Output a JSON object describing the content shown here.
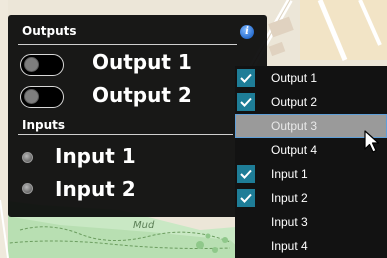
{
  "map": {
    "label": "Mud"
  },
  "panel": {
    "outputs_title": "Outputs",
    "inputs_title": "Inputs",
    "info_icon": "i",
    "outputs": [
      {
        "label": "Output 1",
        "state": "off"
      },
      {
        "label": "Output 2",
        "state": "off"
      }
    ],
    "inputs": [
      {
        "label": "Input 1",
        "state": "inactive"
      },
      {
        "label": "Input 2",
        "state": "inactive"
      }
    ]
  },
  "menu": {
    "items": [
      {
        "label": "Output 1",
        "checked": true
      },
      {
        "label": "Output 2",
        "checked": true
      },
      {
        "label": "Output 3",
        "checked": false,
        "highlighted": true
      },
      {
        "label": "Output 4",
        "checked": false
      },
      {
        "label": "Input 1",
        "checked": true
      },
      {
        "label": "Input 2",
        "checked": true
      },
      {
        "label": "Input 3",
        "checked": false
      },
      {
        "label": "Input 4",
        "checked": false
      }
    ]
  },
  "colors": {
    "panel_bg": "#080808",
    "check_bg": "#1e7d97",
    "highlight_bg": "#9a9a9a",
    "info_icon": "#2a6fd0"
  },
  "icons": {
    "check": "check-icon",
    "cursor": "mouse-pointer-icon",
    "info": "info-icon"
  }
}
